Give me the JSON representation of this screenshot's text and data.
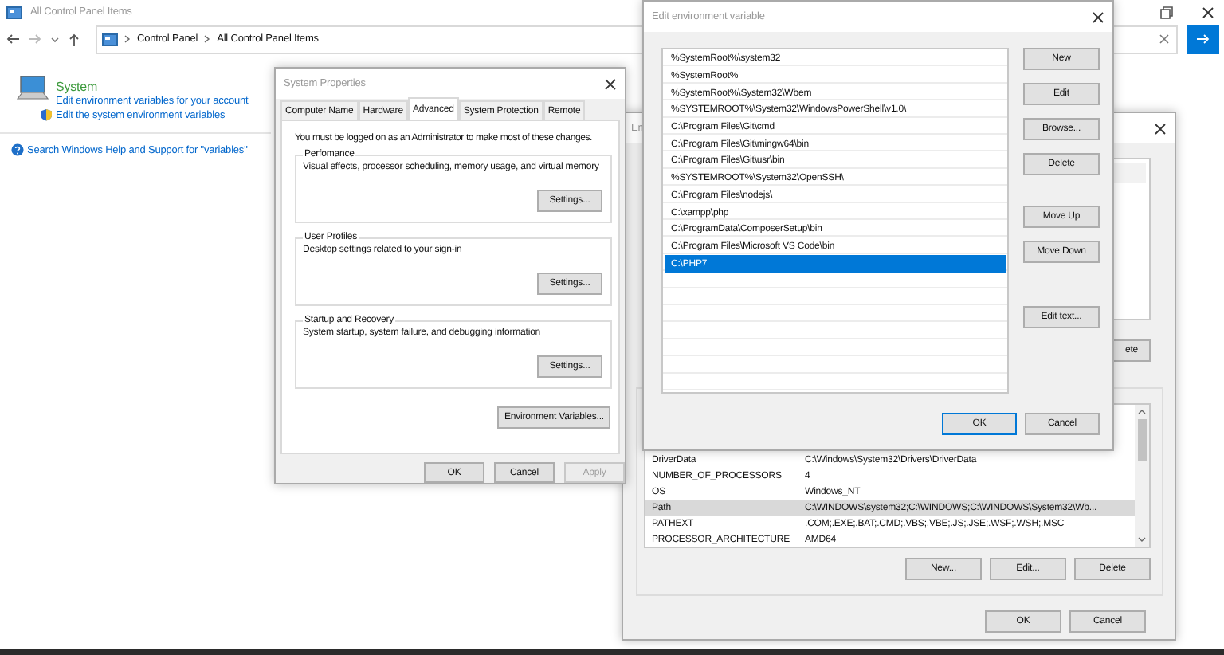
{
  "control_panel": {
    "title": "All Control Panel Items",
    "breadcrumb": [
      "Control Panel",
      "All Control Panel Items"
    ],
    "system": {
      "heading": "System",
      "links": [
        "Edit environment variables for your account",
        "Edit the system environment variables"
      ]
    },
    "help_link": "Search Windows Help and Support for \"variables\""
  },
  "system_properties": {
    "title": "System Properties",
    "tabs": [
      {
        "label": "Computer Name",
        "selected": false
      },
      {
        "label": "Hardware",
        "selected": false
      },
      {
        "label": "Advanced",
        "selected": true
      },
      {
        "label": "System Protection",
        "selected": false
      },
      {
        "label": "Remote",
        "selected": false
      }
    ],
    "notice": "You must be logged on as an Administrator to make most of these changes.",
    "groups": [
      {
        "title": "Perfomance",
        "description": "Visual effects, processor scheduling, memory usage, and virtual memory",
        "button": "Settings..."
      },
      {
        "title": "User Profiles",
        "description": "Desktop settings related to your sign-in",
        "button": "Settings..."
      },
      {
        "title": "Startup and Recovery",
        "description": "System startup, system failure, and debugging information",
        "button": "Settings..."
      }
    ],
    "environment_button": "Environment Variables...",
    "buttons": [
      {
        "label": "OK",
        "disabled": false
      },
      {
        "label": "Cancel",
        "disabled": false
      },
      {
        "label": "Apply",
        "disabled": true
      }
    ]
  },
  "environment_variables": {
    "title": "En",
    "user_button": "ete",
    "system_rows": [
      {
        "name": "DriverData",
        "value": "C:\\Windows\\System32\\Drivers\\DriverData",
        "selected": false
      },
      {
        "name": "NUMBER_OF_PROCESSORS",
        "value": "4",
        "selected": false
      },
      {
        "name": "OS",
        "value": "Windows_NT",
        "selected": false
      },
      {
        "name": "Path",
        "value": "C:\\WINDOWS\\system32;C:\\WINDOWS;C:\\WINDOWS\\System32\\Wb...",
        "selected": true
      },
      {
        "name": "PATHEXT",
        "value": ".COM;.EXE;.BAT;.CMD;.VBS;.VBE;.JS;.JSE;.WSF;.WSH;.MSC",
        "selected": false
      },
      {
        "name": "PROCESSOR_ARCHITECTURE",
        "value": "AMD64",
        "selected": false
      }
    ],
    "system_buttons": [
      "New...",
      "Edit...",
      "Delete"
    ],
    "buttons": [
      {
        "label": "OK",
        "default": false
      },
      {
        "label": "Cancel",
        "default": false
      }
    ]
  },
  "edit_dialog": {
    "title": "Edit environment variable",
    "entries": [
      {
        "text": "%SystemRoot%\\system32",
        "selected": false
      },
      {
        "text": "%SystemRoot%",
        "selected": false
      },
      {
        "text": "%SystemRoot%\\System32\\Wbem",
        "selected": false
      },
      {
        "text": "%SYSTEMROOT%\\System32\\WindowsPowerShell\\v1.0\\",
        "selected": false
      },
      {
        "text": "C:\\Program Files\\Git\\cmd",
        "selected": false
      },
      {
        "text": "C:\\Program Files\\Git\\mingw64\\bin",
        "selected": false
      },
      {
        "text": "C:\\Program Files\\Git\\usr\\bin",
        "selected": false
      },
      {
        "text": "%SYSTEMROOT%\\System32\\OpenSSH\\",
        "selected": false
      },
      {
        "text": "C:\\Program Files\\nodejs\\",
        "selected": false
      },
      {
        "text": "C:\\xampp\\php",
        "selected": false
      },
      {
        "text": "C:\\ProgramData\\ComposerSetup\\bin",
        "selected": false
      },
      {
        "text": "C:\\Program Files\\Microsoft VS Code\\bin",
        "selected": false
      },
      {
        "text": "C:\\PHP7",
        "selected": true
      }
    ],
    "button_groups": [
      [
        "New",
        "Edit",
        "Browse...",
        "Delete"
      ],
      [
        "Move Up",
        "Move Down"
      ],
      [
        "Edit text..."
      ]
    ],
    "buttons": [
      {
        "label": "OK",
        "default": true
      },
      {
        "label": "Cancel",
        "default": false
      }
    ]
  }
}
